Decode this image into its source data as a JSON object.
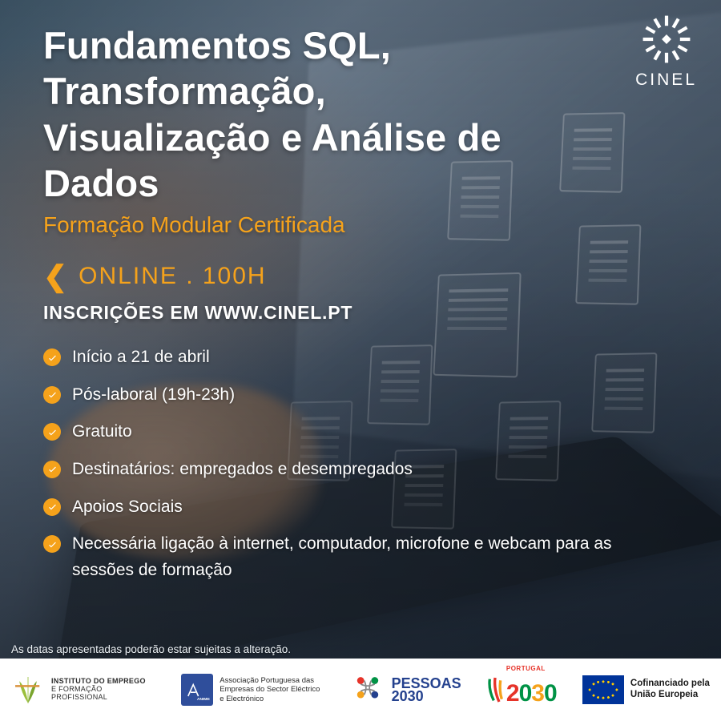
{
  "brand": {
    "name": "CINEL"
  },
  "title": "Fundamentos SQL, Transformação, Visualização e Análise de Dados",
  "subtitle": "Formação Modular Certificada",
  "mode": "ONLINE . 100H",
  "enroll_label": "INSCRIÇÕES EM WWW.CINEL.PT",
  "bullets": [
    "Início a 21 de abril",
    "Pós-laboral (19h-23h)",
    "Gratuito",
    "Destinatários: empregados e desempregados",
    "Apoios Sociais",
    "Necessária ligação à internet, computador, microfone e webcam para as sessões de formação"
  ],
  "disclaimer": "As datas apresentadas poderão estar sujeitas a alteração.",
  "footer": {
    "iefp_line1": "INSTITUTO DO EMPREGO",
    "iefp_line2": "E FORMAÇÃO PROFISSIONAL",
    "animee": "Associação Portuguesa das Empresas do Sector Eléctrico e Electrónico",
    "pessoas_l1": "PESSOAS",
    "pessoas_l2": "2030",
    "portugal_label": "PORTUGAL",
    "portugal_num": "2030",
    "eu_l1": "Cofinanciado pela",
    "eu_l2": "União Europeia"
  },
  "colors": {
    "accent": "#f5a21b"
  }
}
